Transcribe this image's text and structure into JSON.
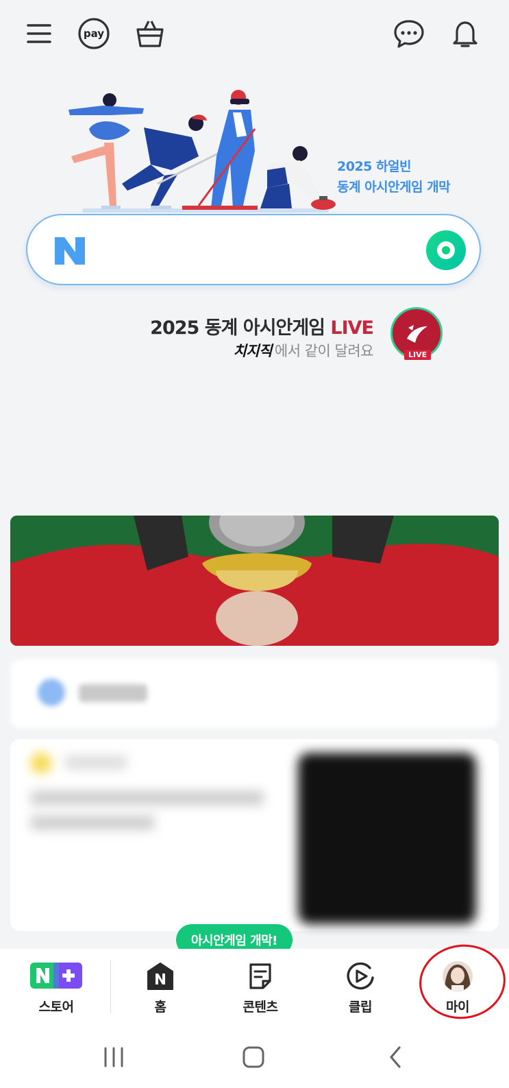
{
  "header": {
    "menu_icon": "hamburger-menu-icon",
    "pay_label": "pay",
    "shopping_icon": "shopping-bag-icon",
    "chat_icon": "chat-bubble-icon",
    "notification_icon": "bell-icon"
  },
  "hero": {
    "caption_line1": "2025 하얼빈",
    "caption_line2": "동계 아시안게임 개막"
  },
  "search": {
    "logo": "N",
    "placeholder": "",
    "green_button_icon": "green-dot-icon"
  },
  "promo": {
    "title_main": "2025 동계 아시안게임 ",
    "title_live": "LIVE",
    "sub_brand": "치지직",
    "sub_text": "에서 같이 달려요",
    "badge_label": "LIVE"
  },
  "toast": {
    "label": "아시안게임 개막!"
  },
  "bottom_nav": {
    "items": [
      {
        "label": "스토어",
        "icon": "nplus-store-icon"
      },
      {
        "label": "홈",
        "icon": "home-icon"
      },
      {
        "label": "콘텐츠",
        "icon": "contents-icon"
      },
      {
        "label": "클립",
        "icon": "clip-play-icon"
      },
      {
        "label": "마이",
        "icon": "profile-avatar-icon"
      }
    ]
  },
  "colors": {
    "accent_green": "#14c77b",
    "search_border": "#7ab6ee",
    "hero_caption": "#3d8ee8",
    "live_red": "#c5283d",
    "highlight_circle": "#e0101c"
  }
}
